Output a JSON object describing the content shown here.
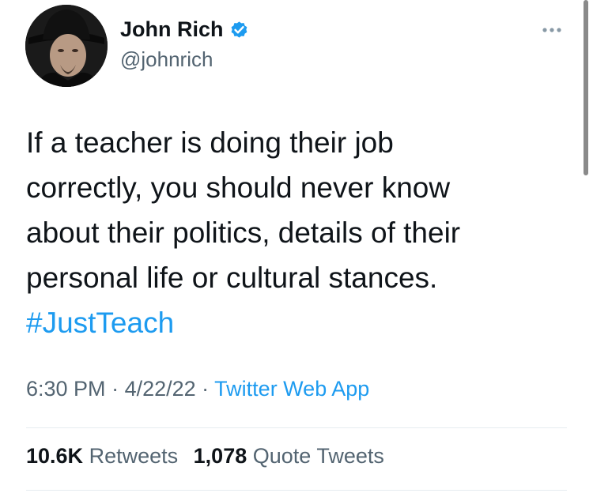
{
  "author": {
    "display_name": "John Rich",
    "handle": "@johnrich",
    "verified": true
  },
  "tweet": {
    "lines": [
      "If a teacher is doing their job",
      "correctly, you should never know",
      "about their politics, details of their",
      "personal life or cultural stances."
    ],
    "hashtag": "#JustTeach"
  },
  "meta": {
    "time": "6:30 PM",
    "separator1": " · ",
    "date": "4/22/22",
    "separator2": " · ",
    "source": "Twitter Web App"
  },
  "stats": {
    "retweets_count": "10.6K",
    "retweets_label": "Retweets",
    "quotes_count": "1,078",
    "quotes_label": "Quote Tweets"
  },
  "icons": {
    "verified": "verified-badge-icon",
    "more": "more-options-icon"
  },
  "colors": {
    "link": "#1d9bf0",
    "secondary_text": "#536471",
    "primary_text": "#0f1419"
  }
}
